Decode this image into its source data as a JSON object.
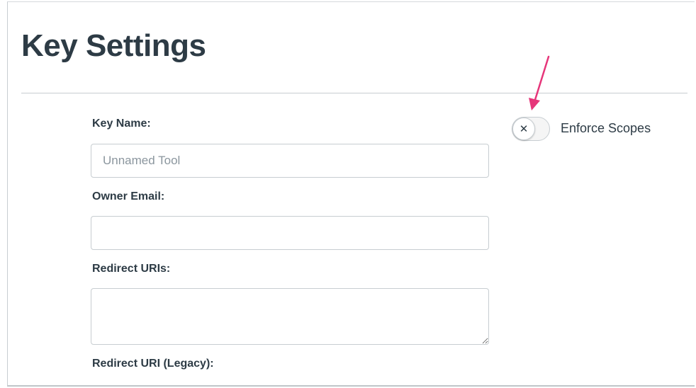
{
  "header": {
    "title": "Key Settings"
  },
  "form": {
    "key_name": {
      "label": "Key Name:",
      "placeholder": "Unnamed Tool",
      "value": ""
    },
    "owner_email": {
      "label": "Owner Email:",
      "value": ""
    },
    "redirect_uris": {
      "label": "Redirect URIs:",
      "value": ""
    },
    "redirect_uri_legacy": {
      "label": "Redirect URI (Legacy):"
    }
  },
  "enforce_scopes": {
    "label": "Enforce Scopes",
    "state": "off",
    "knob_icon": "close-icon"
  },
  "annotation": {
    "arrow_color": "#e6367a",
    "icon": "arrow-down-icon"
  },
  "colors": {
    "text": "#2d3b45",
    "border": "#c7cdd1",
    "placeholder": "#8b969e"
  }
}
